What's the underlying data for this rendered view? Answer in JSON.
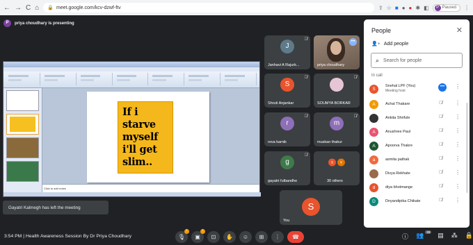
{
  "browser": {
    "url": "meet.google.com/kcv-dzwf-ftv",
    "profile_initial": "P",
    "profile_status": "Paused"
  },
  "presenter": {
    "initial": "P",
    "text": "priya choudhary is presenting"
  },
  "slide": {
    "quote": "If i starve myself i'll get slim..",
    "notes": "Click to add notes"
  },
  "toast": "Gayatri Kalmegh has left the meeting",
  "tiles": [
    {
      "name": "Janhavi A Rajurk...",
      "initial": "J",
      "color": "#5f7a8a"
    },
    {
      "name": "priya choudhary",
      "initial": "",
      "color": ""
    },
    {
      "name": "Shruti Anjankar",
      "initial": "S",
      "color": "#e8542e"
    },
    {
      "name": "SOUMYA BORKAR",
      "initial": "",
      "color": ""
    },
    {
      "name": "reva karnik",
      "initial": "r",
      "color": "#8e6fb8"
    },
    {
      "name": "muskan thakur",
      "initial": "m",
      "color": "#8e6fb8"
    },
    {
      "name": "gayatri fulbandhe",
      "initial": "g",
      "color": "#3f7a4b"
    },
    {
      "name": "30 others",
      "initial": "",
      "color": ""
    },
    {
      "name": "You",
      "initial": "S",
      "color": "#e8542e"
    }
  ],
  "others_avatars": [
    {
      "l": "s",
      "c": "#e8542e"
    },
    {
      "l": "v",
      "c": "#e37400"
    }
  ],
  "panel": {
    "title": "People",
    "add_label": "Add people",
    "search_placeholder": "Search for people",
    "section": "In call",
    "people": [
      {
        "name": "Snehal LPF (You)",
        "sub": "Meeting host",
        "initial": "S",
        "color": "#e8542e"
      },
      {
        "name": "Achal Thakare",
        "sub": "",
        "initial": "A",
        "color": "#f29900"
      },
      {
        "name": "Ankita Shirfule",
        "sub": "",
        "initial": "",
        "color": "#333"
      },
      {
        "name": "Anushree Paul",
        "sub": "",
        "initial": "A",
        "color": "#e8546e"
      },
      {
        "name": "Apoorva Thakre",
        "sub": "",
        "initial": "A",
        "color": "#1e5631"
      },
      {
        "name": "asmita pathak",
        "sub": "",
        "initial": "a",
        "color": "#f06a3e"
      },
      {
        "name": "Divya Rekhate",
        "sub": "",
        "initial": "",
        "color": "#9a6b4a"
      },
      {
        "name": "diya bhotmange",
        "sub": "",
        "initial": "d",
        "color": "#e8542e"
      },
      {
        "name": "Dnyandipika Chikate",
        "sub": "",
        "initial": "D",
        "color": "#0b8a7a"
      }
    ]
  },
  "bottom": {
    "time": "3:54 PM",
    "separator": "|",
    "title": "Health Awareness Session By Dr Priya Choudhary",
    "people_count": "38"
  }
}
